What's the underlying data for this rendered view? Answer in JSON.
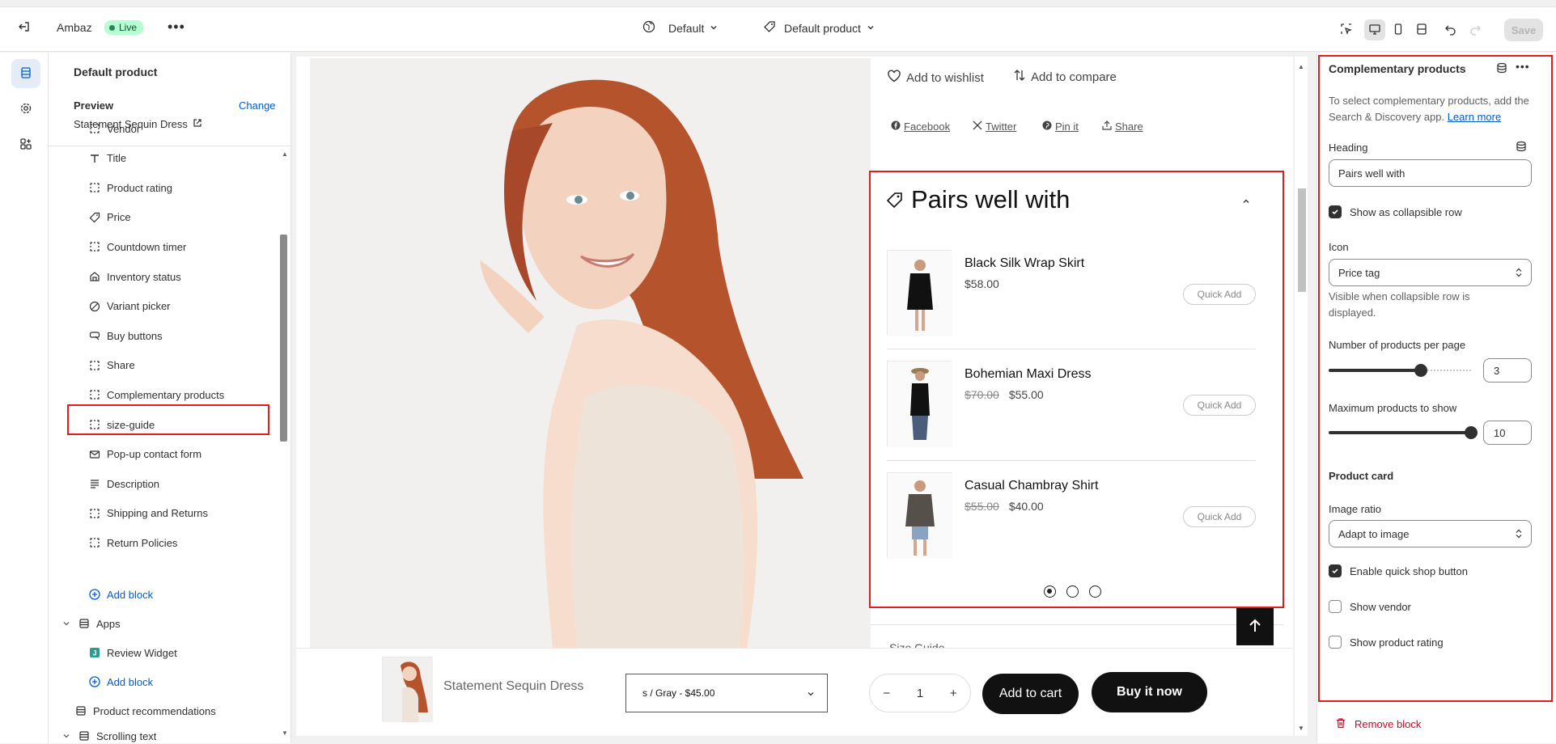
{
  "topbar": {
    "store_name": "Ambaz",
    "live_label": "Live",
    "theme_label": "Default",
    "template_label": "Default product",
    "save_label": "Save"
  },
  "sidebar": {
    "title": "Default product",
    "preview_label": "Preview",
    "change_label": "Change",
    "preview_value": "Statement Sequin Dress",
    "blocks": [
      {
        "label": "Vendor",
        "icon": "block-icon"
      },
      {
        "label": "Title",
        "icon": "text-icon"
      },
      {
        "label": "Product rating",
        "icon": "block-icon"
      },
      {
        "label": "Price",
        "icon": "price-tag-icon"
      },
      {
        "label": "Countdown timer",
        "icon": "block-icon"
      },
      {
        "label": "Inventory status",
        "icon": "inventory-icon"
      },
      {
        "label": "Variant picker",
        "icon": "variant-icon"
      },
      {
        "label": "Buy buttons",
        "icon": "buy-buttons-icon"
      },
      {
        "label": "Share",
        "icon": "block-icon"
      },
      {
        "label": "Complementary products",
        "icon": "block-icon"
      },
      {
        "label": "size-guide",
        "icon": "block-icon"
      },
      {
        "label": "Pop-up contact form",
        "icon": "mail-icon"
      },
      {
        "label": "Description",
        "icon": "text-lines-icon"
      },
      {
        "label": "Shipping and Returns",
        "icon": "block-icon"
      },
      {
        "label": "Return Policies",
        "icon": "block-icon"
      }
    ],
    "add_block_label": "Add block",
    "apps_label": "Apps",
    "review_widget_label": "Review Widget",
    "add_block_label_2": "Add block",
    "product_recommendations_label": "Product recommendations",
    "scrolling_text_label": "Scrolling text"
  },
  "canvas": {
    "wishlist_label": "Add to wishlist",
    "compare_label": "Add to compare",
    "share_links": [
      "Facebook",
      "Twitter",
      "Pin it",
      "Share"
    ],
    "complementary_heading": "Pairs well with",
    "products": [
      {
        "name": "Black Silk Wrap Skirt",
        "price": "$58.00",
        "compare_price": ""
      },
      {
        "name": "Bohemian Maxi Dress",
        "price": "$55.00",
        "compare_price": "$70.00"
      },
      {
        "name": "Casual Chambray Shirt",
        "price": "$40.00",
        "compare_price": "$55.00"
      }
    ],
    "quick_add_label": "Quick Add",
    "size_guide_peek": "Size Guide",
    "sticky": {
      "product_name": "Statement Sequin Dress",
      "variant": "s / Gray - $45.00",
      "quantity": "1",
      "add_to_cart": "Add to cart",
      "buy_now": "Buy it now"
    }
  },
  "settings": {
    "title": "Complementary products",
    "intro": "To select complementary products, add the Search & Discovery app.",
    "learn_more": "Learn more",
    "heading_label": "Heading",
    "heading_value": "Pairs well with",
    "collapsible_label": "Show as collapsible row",
    "collapsible_checked": true,
    "icon_label": "Icon",
    "icon_value": "Price tag",
    "icon_help": "Visible when collapsible row is displayed.",
    "per_page_label": "Number of products per page",
    "per_page_value": "3",
    "per_page_fraction": 0.65,
    "max_label": "Maximum products to show",
    "max_value": "10",
    "max_fraction": 1.0,
    "product_card_label": "Product card",
    "image_ratio_label": "Image ratio",
    "image_ratio_value": "Adapt to image",
    "quick_shop_label": "Enable quick shop button",
    "quick_shop_checked": true,
    "show_vendor_label": "Show vendor",
    "show_vendor_checked": false,
    "show_rating_label": "Show product rating",
    "show_rating_checked": false,
    "remove_label": "Remove block"
  },
  "colors": {
    "accent_blue": "#005bd3",
    "highlight_red": "#e51c1c",
    "live_green": "#29845a",
    "remove_red": "#c70a24"
  }
}
